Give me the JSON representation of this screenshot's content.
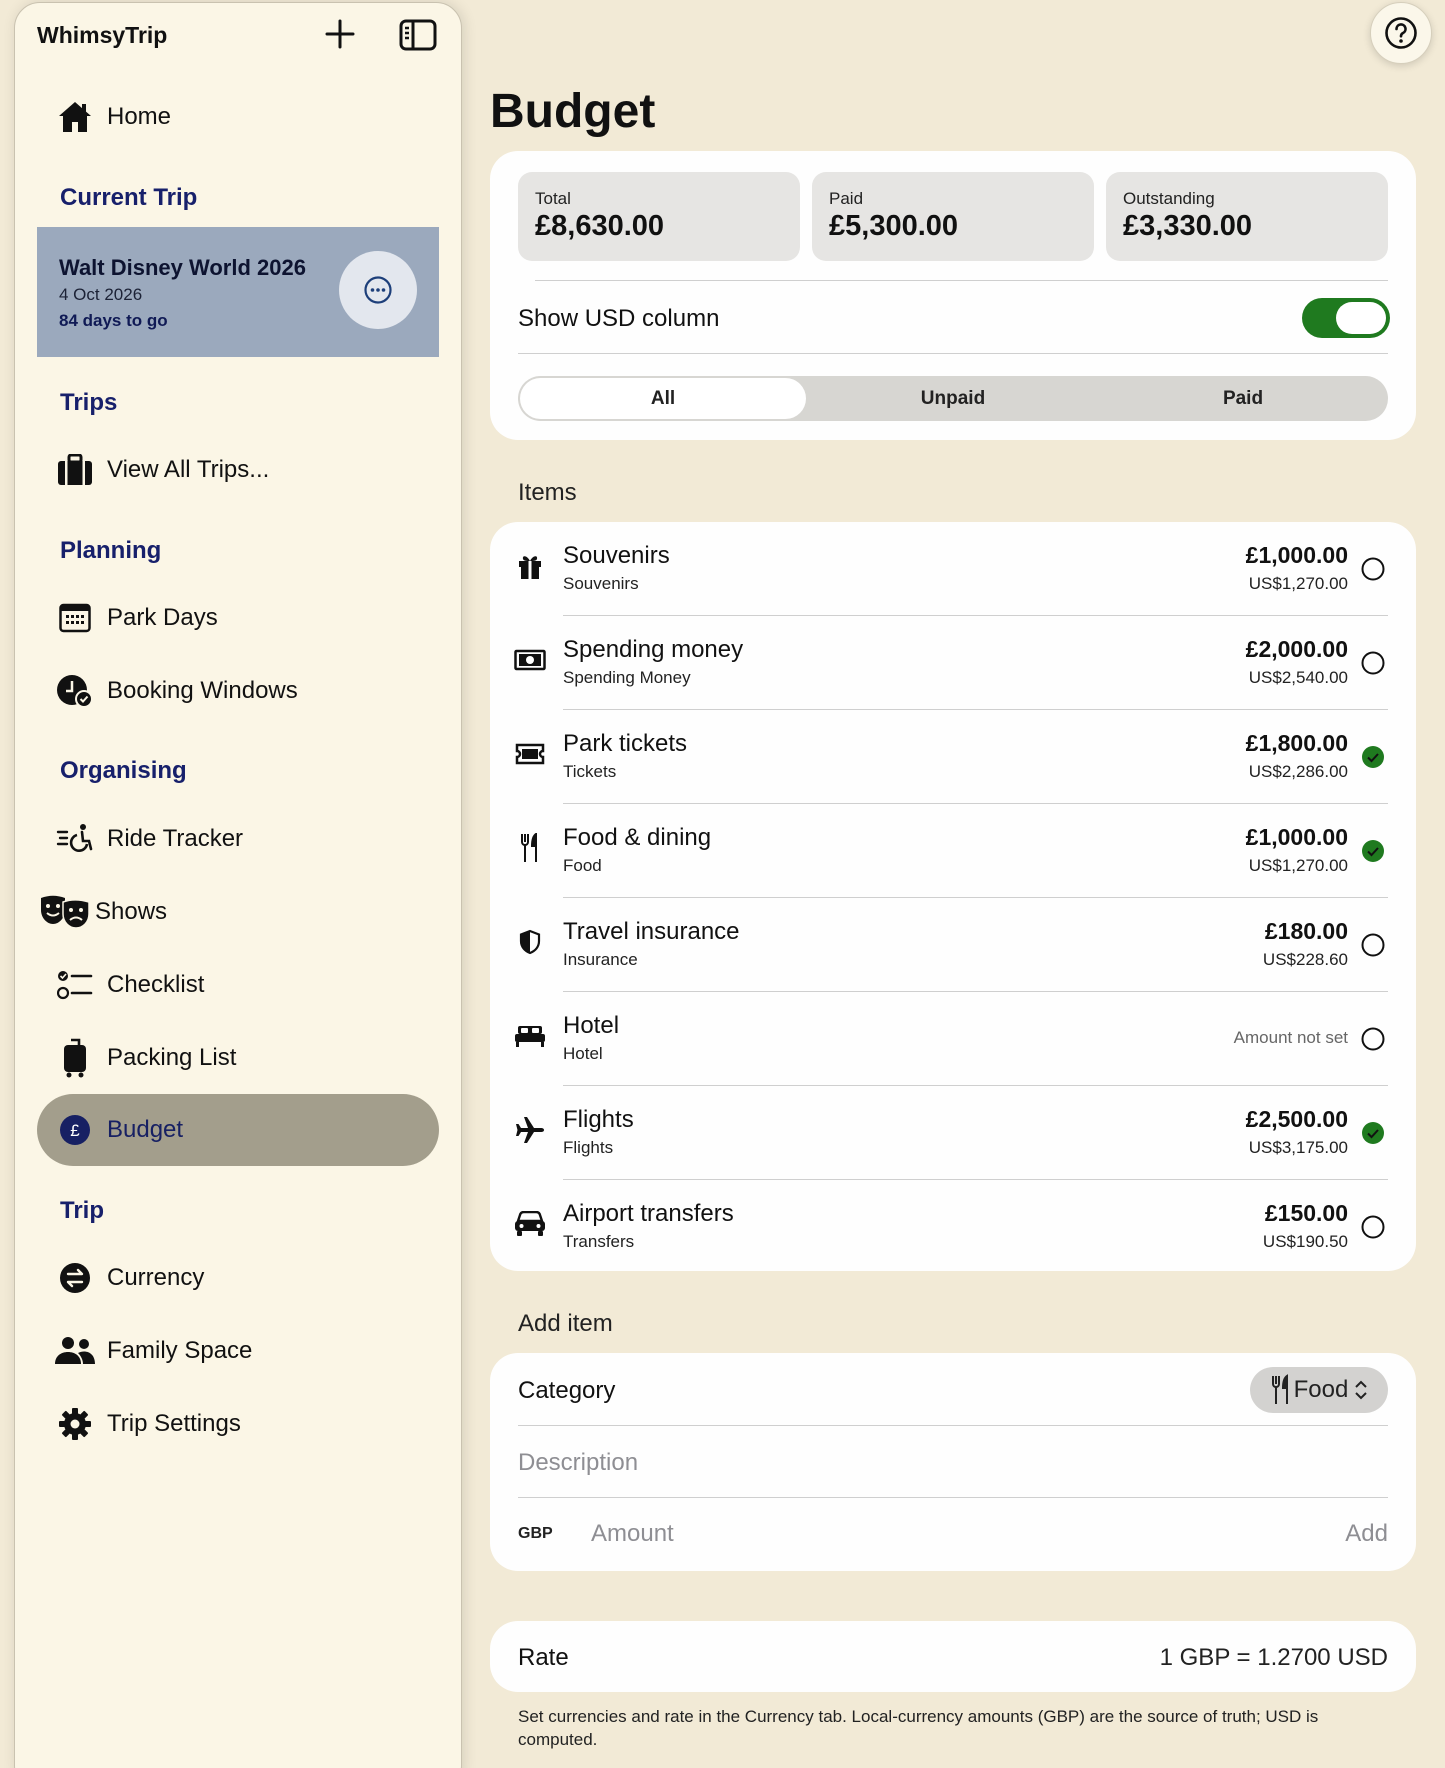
{
  "app": {
    "title": "WhimsyTrip"
  },
  "sidebar": {
    "home": "Home",
    "current_trip_header": "Current Trip",
    "current_trip": {
      "name": "Walt Disney World 2026",
      "date": "4 Oct 2026",
      "countdown": "84 days to go"
    },
    "trips_header": "Trips",
    "view_all": "View All Trips...",
    "planning_header": "Planning",
    "park_days": "Park Days",
    "booking_windows": "Booking Windows",
    "organising_header": "Organising",
    "ride_tracker": "Ride Tracker",
    "shows": "Shows",
    "checklist": "Checklist",
    "packing_list": "Packing List",
    "budget": "Budget",
    "trip_header": "Trip",
    "currency": "Currency",
    "family_space": "Family Space",
    "trip_settings": "Trip Settings"
  },
  "main": {
    "title": "Budget",
    "summary": {
      "total_label": "Total",
      "total_value": "£8,630.00",
      "paid_label": "Paid",
      "paid_value": "£5,300.00",
      "outstanding_label": "Outstanding",
      "outstanding_value": "£3,330.00"
    },
    "show_usd_label": "Show USD column",
    "show_usd_on": true,
    "segments": [
      "All",
      "Unpaid",
      "Paid"
    ],
    "selected_segment": "All",
    "items_header": "Items",
    "items": [
      {
        "icon": "gift-icon",
        "title": "Souvenirs",
        "category": "Souvenirs",
        "amount": "£1,000.00",
        "usd": "US$1,270.00",
        "paid": false
      },
      {
        "icon": "banknote-icon",
        "title": "Spending money",
        "category": "Spending Money",
        "amount": "£2,000.00",
        "usd": "US$2,540.00",
        "paid": false
      },
      {
        "icon": "ticket-icon",
        "title": "Park tickets",
        "category": "Tickets",
        "amount": "£1,800.00",
        "usd": "US$2,286.00",
        "paid": true
      },
      {
        "icon": "fork-knife-icon",
        "title": "Food & dining",
        "category": "Food",
        "amount": "£1,000.00",
        "usd": "US$1,270.00",
        "paid": true
      },
      {
        "icon": "shield-icon",
        "title": "Travel insurance",
        "category": "Insurance",
        "amount": "£180.00",
        "usd": "US$228.60",
        "paid": false
      },
      {
        "icon": "bed-icon",
        "title": "Hotel",
        "category": "Hotel",
        "not_set": "Amount not set",
        "paid": false
      },
      {
        "icon": "airplane-icon",
        "title": "Flights",
        "category": "Flights",
        "amount": "£2,500.00",
        "usd": "US$3,175.00",
        "paid": true
      },
      {
        "icon": "car-icon",
        "title": "Airport transfers",
        "category": "Transfers",
        "amount": "£150.00",
        "usd": "US$190.50",
        "paid": false
      }
    ],
    "add_header": "Add item",
    "add": {
      "category_label": "Category",
      "category_value": "Food",
      "description_placeholder": "Description",
      "currency_code": "GBP",
      "amount_placeholder": "Amount",
      "add_label": "Add"
    },
    "rate": {
      "label": "Rate",
      "value": "1 GBP = 1.2700 USD"
    },
    "footnote": "Set currencies and rate in the Currency tab. Local-currency amounts (GBP) are the source of truth; USD is computed."
  },
  "colors": {
    "accent_green": "#1f7a1f",
    "nav_blue": "#17206b",
    "background": "#f2ead6"
  }
}
